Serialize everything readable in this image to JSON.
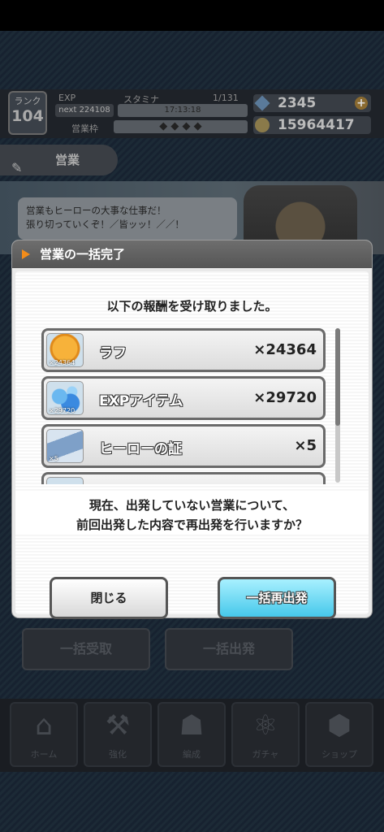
{
  "hud": {
    "rank_label": "ランク",
    "rank_value": "104",
    "exp_label": "EXP",
    "exp_next": "next 224108",
    "stamina_label": "スタミナ",
    "stamina_value": "1/131",
    "stamina_time": "17:13:18",
    "sales_slot_label": "営業枠",
    "sales_slot_marks": "◆ ◆ ◆ ◆",
    "gems": "2345",
    "coins": "15964417"
  },
  "sales_header": {
    "label": "営業"
  },
  "speech": {
    "text": "営業もヒーローの大事な仕事だ！\n張り切っていくぞ！／皆ッッ！／／！"
  },
  "background_buttons": {
    "bulk_receive": "一括受取",
    "bulk_dispatch": "一括出発"
  },
  "bottom_nav": [
    {
      "label": "ホーム",
      "icon": "home-icon"
    },
    {
      "label": "強化",
      "icon": "dumbbell-icon"
    },
    {
      "label": "編成",
      "icon": "team-icon"
    },
    {
      "label": "ガチャ",
      "icon": "orbit-icon"
    },
    {
      "label": "ショップ",
      "icon": "shop-icon"
    }
  ],
  "modal": {
    "title": "営業の一括完了",
    "message": "以下の報酬を受け取りました。",
    "rewards": [
      {
        "name": "ラフ",
        "quantity": "×24364",
        "thumb_count": "×24364"
      },
      {
        "name": "EXPアイテム",
        "quantity": "×29720",
        "thumb_count": "×29720"
      },
      {
        "name": "ヒーローの証",
        "quantity": "×5",
        "thumb_count": "×5"
      }
    ],
    "question_line1": "現在、出発していない営業について、",
    "question_line2": "前回出発した内容で再出発を行いますか？",
    "close_label": "閉じる",
    "redispatch_label": "一括再出発"
  },
  "colors": {
    "accent": "#f28c1a",
    "redispatch": "#46c8ea"
  }
}
